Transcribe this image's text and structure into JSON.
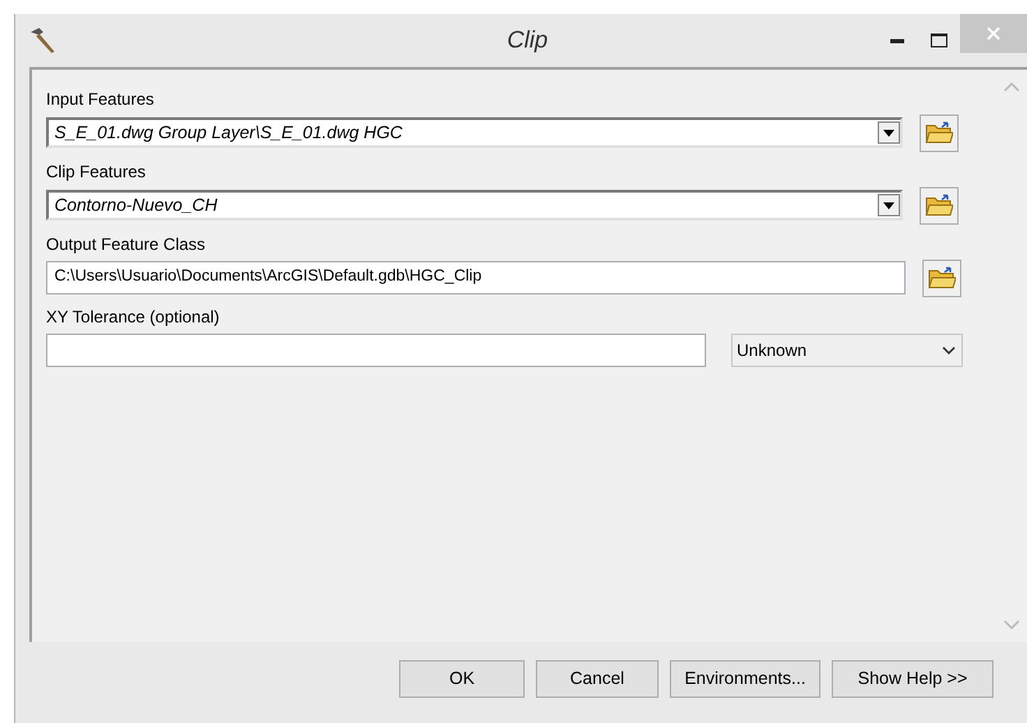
{
  "window": {
    "title": "Clip"
  },
  "parameters": [
    {
      "label": "Input Features",
      "kind": "combo",
      "value": "S_E_01.dwg Group Layer\\S_E_01.dwg HGC"
    },
    {
      "label": "Clip Features",
      "kind": "combo",
      "value": "Contorno-Nuevo_CH"
    },
    {
      "label": "Output Feature Class",
      "kind": "path",
      "value": "C:\\Users\\Usuario\\Documents\\ArcGIS\\Default.gdb\\HGC_Clip"
    },
    {
      "label": "XY Tolerance (optional)",
      "kind": "tolerance",
      "unit": "Unknown"
    }
  ],
  "buttons": [
    "OK",
    "Cancel",
    "Environments...",
    "Show Help >>"
  ]
}
